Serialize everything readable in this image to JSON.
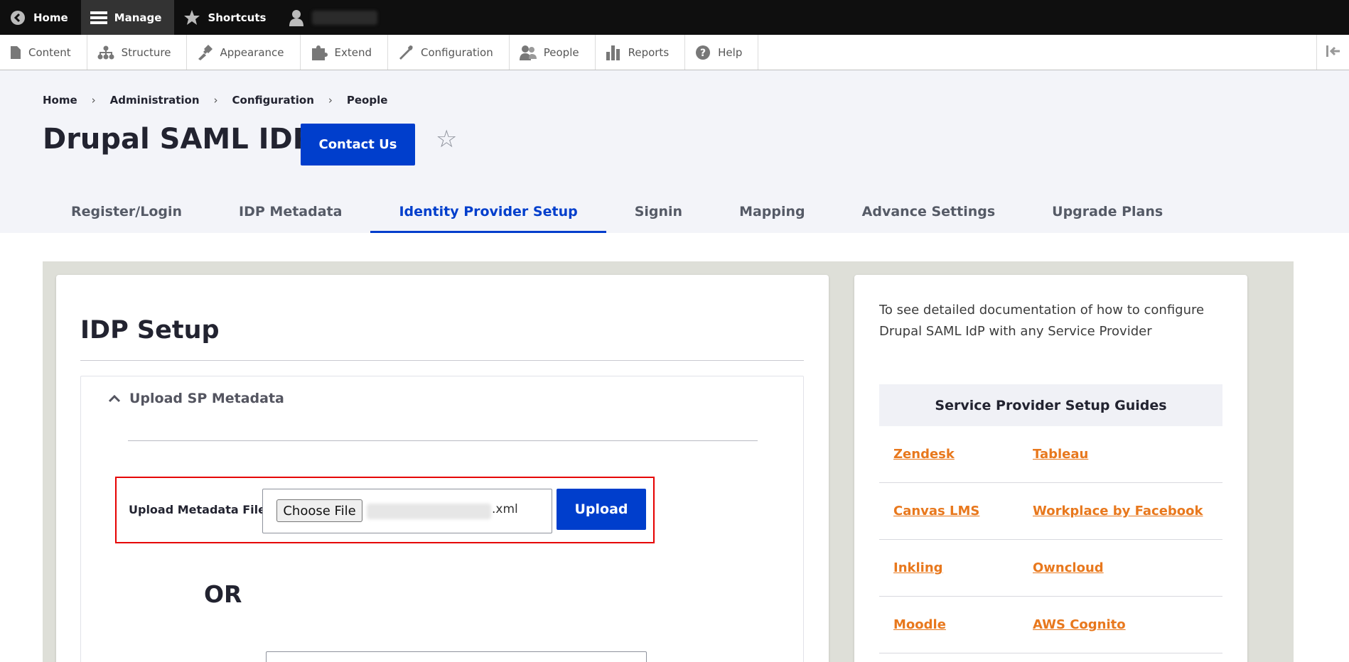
{
  "toolbar": {
    "home": "Home",
    "manage": "Manage",
    "shortcuts": "Shortcuts"
  },
  "tray": {
    "items": [
      {
        "label": "Content",
        "icon": "file-icon"
      },
      {
        "label": "Structure",
        "icon": "structure-icon"
      },
      {
        "label": "Appearance",
        "icon": "paintbrush-icon"
      },
      {
        "label": "Extend",
        "icon": "puzzle-icon"
      },
      {
        "label": "Configuration",
        "icon": "wrench-icon"
      },
      {
        "label": "People",
        "icon": "people-icon"
      },
      {
        "label": "Reports",
        "icon": "bar-chart-icon"
      },
      {
        "label": "Help",
        "icon": "question-icon"
      }
    ]
  },
  "breadcrumb": [
    "Home",
    "Administration",
    "Configuration",
    "People"
  ],
  "page": {
    "title": "Drupal SAML IDP",
    "contact_button": "Contact Us",
    "star": "☆"
  },
  "tabs": [
    {
      "label": "Register/Login",
      "active": false
    },
    {
      "label": "IDP Metadata",
      "active": false
    },
    {
      "label": "Identity Provider Setup",
      "active": true
    },
    {
      "label": "Signin",
      "active": false
    },
    {
      "label": "Mapping",
      "active": false
    },
    {
      "label": "Advance Settings",
      "active": false
    },
    {
      "label": "Upgrade Plans",
      "active": false
    }
  ],
  "main": {
    "heading": "IDP Setup",
    "section_summary": "Upload SP Metadata",
    "upload_label": "Upload Metadata File:",
    "choose_file": "Choose File",
    "file_ext": ".xml",
    "upload_button": "Upload",
    "or_text": "OR"
  },
  "sidebar": {
    "doc_text": "To see detailed documentation of how to configure Drupal SAML IdP with any Service Provider",
    "guides_title": "Service Provider Setup Guides",
    "guides": [
      [
        "Zendesk",
        "Tableau"
      ],
      [
        "Canvas LMS",
        "Workplace by Facebook"
      ],
      [
        "Inkling",
        "Owncloud"
      ],
      [
        "Moodle",
        "AWS Cognito"
      ]
    ]
  },
  "colors": {
    "primary": "#003ecc",
    "link": "#e8781d",
    "highlight_border": "#e60000"
  }
}
